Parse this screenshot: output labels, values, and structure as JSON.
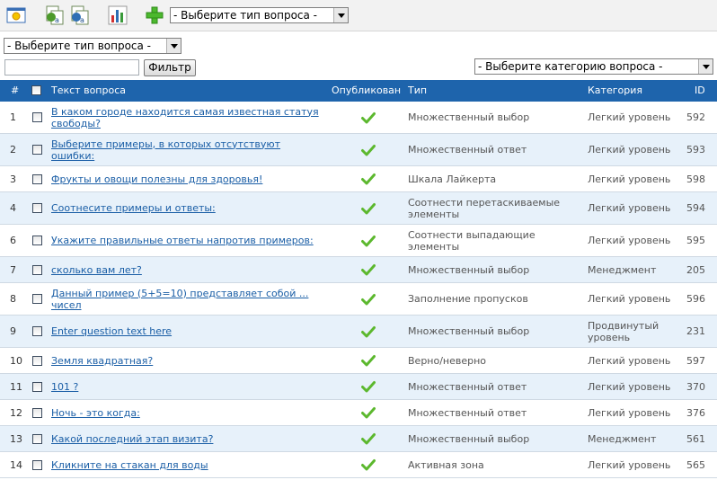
{
  "toolbar": {
    "icons": [
      "new-question-icon",
      "copy-question-icon",
      "move-question-icon",
      "report-chart-icon",
      "add-icon"
    ],
    "type_select": "- Выберите тип вопроса -"
  },
  "filters": {
    "type_select": "- Выберите тип вопроса -",
    "search_value": "",
    "filter_button": "Фильтр",
    "category_select": "- Выберите категорию вопроса -"
  },
  "table": {
    "headers": {
      "num": "#",
      "question": "Текст вопроса",
      "published": "Опубликован",
      "type": "Тип",
      "category": "Категория",
      "id": "ID"
    },
    "rows": [
      {
        "num": "1",
        "question": "В каком городе находится самая известная статуя свободы?",
        "type": "Множественный выбор",
        "category": "Легкий уровень",
        "id": "592"
      },
      {
        "num": "2",
        "question": "Выберите примеры, в которых отсутствуют ошибки:",
        "type": "Множественный ответ",
        "category": "Легкий уровень",
        "id": "593"
      },
      {
        "num": "3",
        "question": "Фрукты и овощи полезны для здоровья!",
        "type": "Шкала Лайкерта",
        "category": "Легкий уровень",
        "id": "598"
      },
      {
        "num": "4",
        "question": "Соотнесите примеры и ответы:",
        "type": "Соотнести перетаскиваемые элементы",
        "category": "Легкий уровень",
        "id": "594"
      },
      {
        "num": "6",
        "question": "Укажите правильные ответы напротив примеров:",
        "type": "Соотнести выпадающие элементы",
        "category": "Легкий уровень",
        "id": "595"
      },
      {
        "num": "7",
        "question": "сколько вам лет?",
        "type": "Множественный выбор",
        "category": "Менеджмент",
        "id": "205"
      },
      {
        "num": "8",
        "question": "Данный пример (5+5=10) представляет собой ... чисел",
        "type": "Заполнение пропусков",
        "category": "Легкий уровень",
        "id": "596"
      },
      {
        "num": "9",
        "question": "Enter question text here",
        "type": "Множественный выбор",
        "category": "Продвинутый уровень",
        "id": "231"
      },
      {
        "num": "10",
        "question": "Земля квадратная?",
        "type": "Верно/неверно",
        "category": "Легкий уровень",
        "id": "597"
      },
      {
        "num": "11",
        "question": "101 ?",
        "type": "Множественный ответ",
        "category": "Легкий уровень",
        "id": "370"
      },
      {
        "num": "12",
        "question": "Ночь - это когда:",
        "type": "Множественный ответ",
        "category": "Легкий уровень",
        "id": "376"
      },
      {
        "num": "13",
        "question": "Какой последний этап визита?",
        "type": "Множественный выбор",
        "category": "Менеджмент",
        "id": "561"
      },
      {
        "num": "14",
        "question": "Кликните на стакан для воды",
        "type": "Активная зона",
        "category": "Легкий уровень",
        "id": "565"
      }
    ]
  },
  "colors": {
    "header_bg": "#1e64ac",
    "row_alt_bg": "#e7f1fa",
    "link": "#1a5ea6",
    "published_check": "#5cb82e"
  }
}
